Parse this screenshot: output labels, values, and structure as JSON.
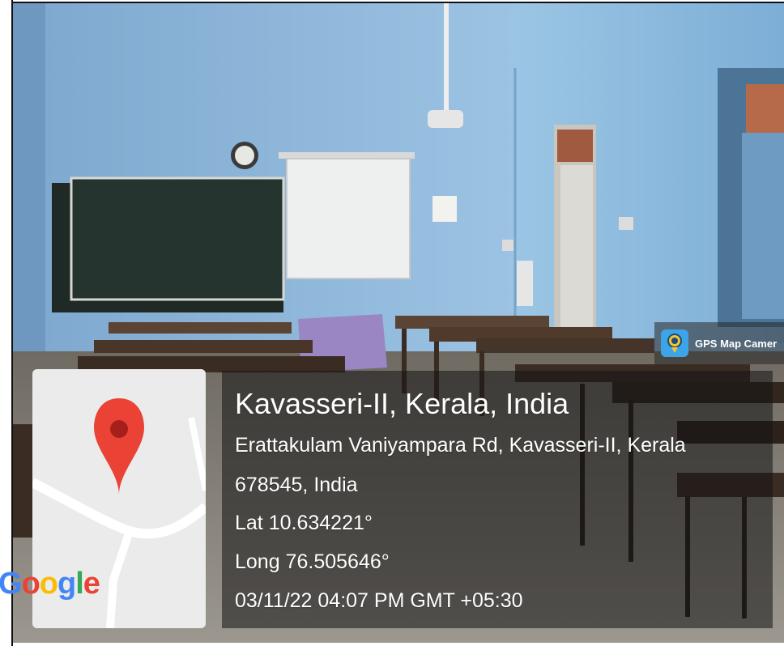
{
  "badge": {
    "app_name": "GPS Map Camer",
    "icon": "gps-map-camera-icon"
  },
  "map": {
    "logo_text": "Google",
    "pin_icon": "location-pin-icon"
  },
  "location": {
    "title": "Kavasseri-II, Kerala, India",
    "address_line1": "Erattakulam Vaniyampara Rd, Kavasseri-II, Kerala",
    "address_line2": "678545, India",
    "latitude": "Lat 10.634221°",
    "longitude": "Long 76.505646°",
    "datetime": "03/11/22 04:07 PM GMT +05:30"
  },
  "colors": {
    "wall": "#8fb9dc",
    "blackboard": "#25342f",
    "screen": "#eef0ef",
    "desk": "#3a2c22",
    "tablecloth": "#9b86c4",
    "pin": "#ea4335",
    "google_blue": "#4285f4",
    "google_red": "#ea4335",
    "google_yellow": "#fbbc05",
    "google_green": "#34a853"
  }
}
